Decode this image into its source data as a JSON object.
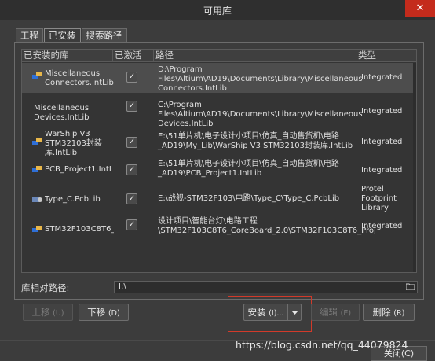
{
  "window": {
    "title": "可用库",
    "close_label": "✕"
  },
  "tabs": [
    {
      "label": "工程"
    },
    {
      "label": "已安装"
    },
    {
      "label": "搜索路径"
    }
  ],
  "table": {
    "headers": [
      "已安装的库",
      "已激活",
      "路径",
      "类型"
    ],
    "rows": [
      {
        "name": "Miscellaneous Connectors.IntLib",
        "active": "✓",
        "path": "D:\\Program Files\\Altium\\AD19\\Documents\\Library\\Miscellaneous Connectors.IntLib",
        "type": "Integrated"
      },
      {
        "name": "Miscellaneous Devices.IntLib",
        "active": "✓",
        "path": "C:\\Program Files\\Altium\\AD19\\Documents\\Library\\Miscellaneous Devices.IntLib",
        "type": "Integrated"
      },
      {
        "name": "WarShip V3 STM32103封装库.IntLib",
        "active": "✓",
        "path": "E:\\51单片机\\电子设计小项目\\仿真_自动售货机\\电路_AD19\\My_Lib\\WarShip V3 STM32103封装库.IntLib",
        "type": "Integrated"
      },
      {
        "name": "PCB_Project1.IntLib",
        "active": "✓",
        "path": "E:\\51单片机\\电子设计小项目\\仿真_自动售货机\\电路_AD19\\PCB_Project1.IntLib",
        "type": "Integrated"
      },
      {
        "name": "Type_C.PcbLib",
        "active": "✓",
        "path": "E:\\战舰-STM32F103\\电路\\Type_C\\Type_C.PcbLib",
        "type": "Protel Footprint Library"
      },
      {
        "name": "STM32F103C8T6_F",
        "active": "✓",
        "path": "设计项目\\智能台灯\\电路工程\\STM32F103C8T6_CoreBoard_2.0\\STM32F103C8T6_Proj",
        "type": "Integrated"
      }
    ]
  },
  "relpath": {
    "label": "库相对路径:",
    "value": "I:\\"
  },
  "buttons": {
    "move_up": "上移",
    "move_up_key": "(U)",
    "move_down": "下移",
    "move_down_key": "(D)",
    "install": "安装",
    "install_key": "(I)...",
    "edit": "编辑",
    "edit_key": "(E)",
    "remove": "删除",
    "remove_key": "(R)",
    "close": "关闭(C)"
  },
  "watermark": "https://blog.csdn.net/qq_44079824",
  "colors": {
    "highlight_border": "#d23a2a",
    "close_button": "#c42b1c"
  },
  "icons": {
    "intlib": "integrated-library-icon",
    "pcblib": "pcb-library-icon",
    "dropdown": "triangle-down-icon",
    "folder": "folder-icon"
  }
}
